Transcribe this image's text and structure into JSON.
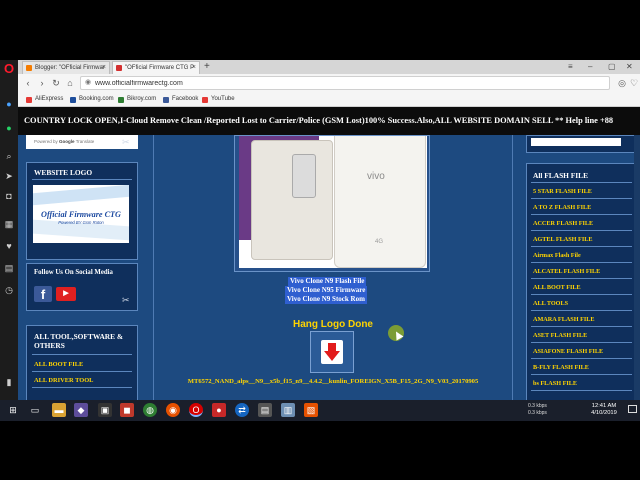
{
  "browser": {
    "tabs": [
      {
        "label": "Blogger: \"OFficial Firmwar",
        "fav_color": "#f57c00"
      },
      {
        "label": "\"OFficial Firmware CTG P",
        "fav_color": "#d32f2f"
      }
    ],
    "new_tab": "+",
    "address": "www.officialfirmwarectg.com",
    "bookmarks": [
      {
        "label": "AliExpress",
        "color": "#e53935"
      },
      {
        "label": "Booking.com",
        "color": "#1e4e9c"
      },
      {
        "label": "Bikroy.com",
        "color": "#2e7d32"
      },
      {
        "label": "Facebook",
        "color": "#3b5998"
      },
      {
        "label": "YouTube",
        "color": "#e53935"
      }
    ]
  },
  "page": {
    "marquee": "COUNTRY LOCK OPEN,I-Cloud Remove Clean /Reported Lost to Carrier/Police (GSM Lost)100% Success.Also,ALL WEBSITE DOMAIN SELL ** Help line +88",
    "powered_by": "Powered by",
    "powered_brand": "Google",
    "powered_suffix": "Translate",
    "website_logo_title": "WEBSITE LOGO",
    "logo_brand": "Official Firmware CTG",
    "logo_tagline": "Powered BY Gsm Raton",
    "social_title": "Follow Us On Social Media",
    "social_fb": "f",
    "social_yt": "▶",
    "all_tool_title": "ALL TOOL,SOFTWARE & OTHERS",
    "left_links": [
      "ALL BOOT FILE",
      "ALL DRIVER TOOL"
    ],
    "phone_brand": "vivo",
    "phone_label": "4G",
    "title_lines": [
      "Vivo Clone N9 Flash File",
      "Vivo Clone N95 Firmware",
      "Vivo Clone N9 Stock Rom"
    ],
    "hang_text": "Hang Logo Done",
    "file_name": "MT6572_NAND_alps__N9__x5b_f15_n9__4.4.2__kunlin_FOREIGN_X5B_F15_2G_N9_V03_20170905",
    "all_flash_title": "All FLASH FILE",
    "right_links": [
      "5 STAR FLASH FILE",
      "A TO Z FLASH FILE",
      "ACCER FLASH FILE",
      "AGTEL FLASH FILE",
      "Airmax Flash File",
      "ALCATEL FLASH FILE",
      "ALL BOOT FILE",
      "ALL TOOLS",
      "AMARA FLASH FILE",
      "ASET FLASH FILE",
      "ASIAFONE FLASH FILE",
      "B-FLY FLASH FILE",
      "bs FLASH FILE"
    ]
  },
  "taskbar": {
    "net_up": "0.3 kbps",
    "net_down": "0.3 kbps",
    "time": "12:41 AM",
    "date": "4/10/2019"
  }
}
